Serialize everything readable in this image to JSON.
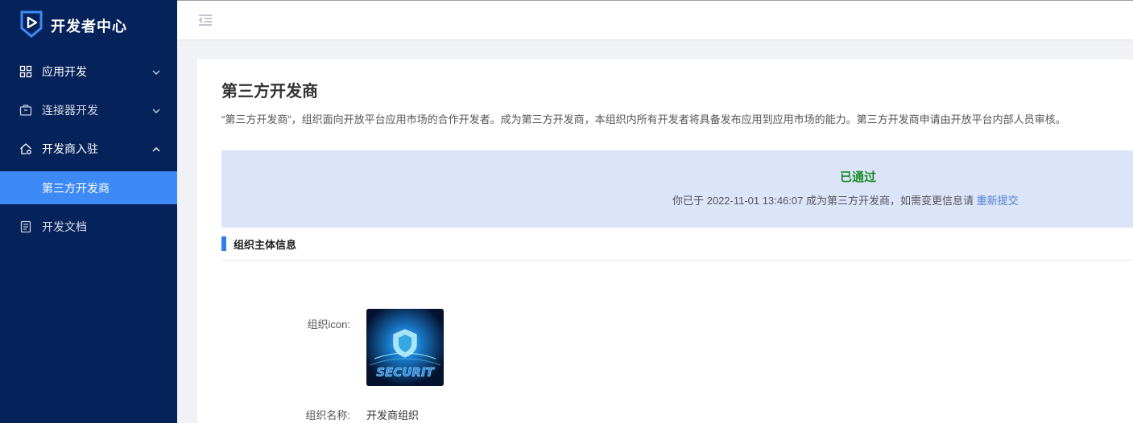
{
  "app": {
    "logo_text": "开发者中心"
  },
  "sidebar": {
    "items": [
      {
        "label": "应用开发"
      },
      {
        "label": "连接器开发"
      },
      {
        "label": "开发商入驻"
      },
      {
        "label": "第三方开发商"
      },
      {
        "label": "开发文档"
      }
    ]
  },
  "page": {
    "title": "第三方开发商",
    "description": "“第三方开发商”，组织面向开放平台应用市场的合作开发者。成为第三方开发商，本组织内所有开发者将具备发布应用到应用市场的能力。第三方开发商申请由开放平台内部人员审核。"
  },
  "status": {
    "title": "已通过",
    "message": "你已于 2022-11-01 13:46:07 成为第三方开发商，如需变更信息请 ",
    "link": "重新提交"
  },
  "section": {
    "title": "组织主体信息"
  },
  "fields": {
    "icon_label": "组织icon:",
    "name_label": "组织名称:",
    "name_value": "开发商组织",
    "icon_text": "SECURIT"
  },
  "colors": {
    "sidebar_bg": "#06225a",
    "active_item": "#3d8af7",
    "status_bg": "#dce4fa",
    "status_ok": "#1a8a22",
    "link": "#4a7fd6"
  }
}
